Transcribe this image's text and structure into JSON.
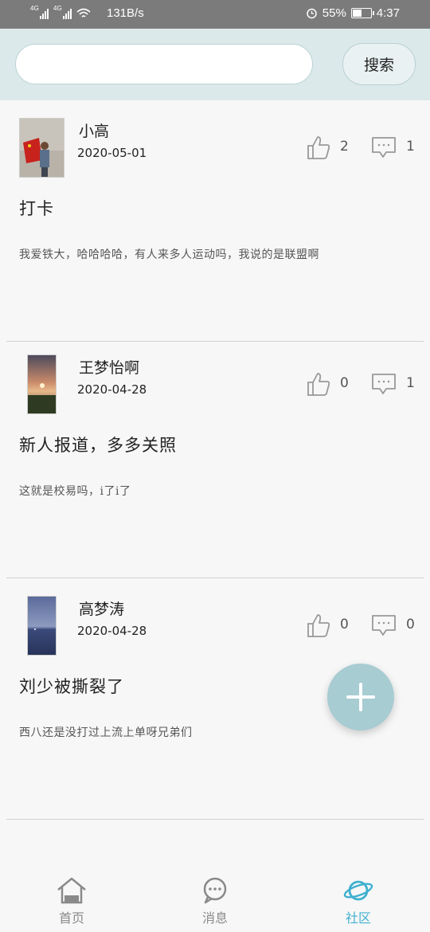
{
  "status_bar": {
    "network_1": "4G",
    "network_2": "4G",
    "speed": "131B/s",
    "battery_percent": "55%",
    "battery_level": 0.55,
    "time": "4:37"
  },
  "search": {
    "placeholder": "",
    "value": "",
    "button_label": "搜索"
  },
  "posts": [
    {
      "username": "小高",
      "date": "2020-05-01",
      "likes": "2",
      "comments": "1",
      "title": "打卡",
      "body": "我爱铁大，哈哈哈哈，有人来多人运动吗，我说的是联盟啊"
    },
    {
      "username": "王梦怡啊",
      "date": "2020-04-28",
      "likes": "0",
      "comments": "1",
      "title": "新人报道，多多关照",
      "body": "这就是校易吗，i了i了"
    },
    {
      "username": "高梦涛",
      "date": "2020-04-28",
      "likes": "0",
      "comments": "0",
      "title": "刘少被撕裂了",
      "body": "西八还是没打过上流上单呀兄弟们"
    }
  ],
  "nav": {
    "items": [
      {
        "label": "首页",
        "icon": "home-icon"
      },
      {
        "label": "消息",
        "icon": "message-icon"
      },
      {
        "label": "社区",
        "icon": "planet-icon"
      }
    ],
    "active_index": 2
  },
  "colors": {
    "header_bg": "#dce9ea",
    "accent": "#3fb0cf",
    "fab": "#a7ccd2",
    "status_bar": "#7b7b7b"
  }
}
